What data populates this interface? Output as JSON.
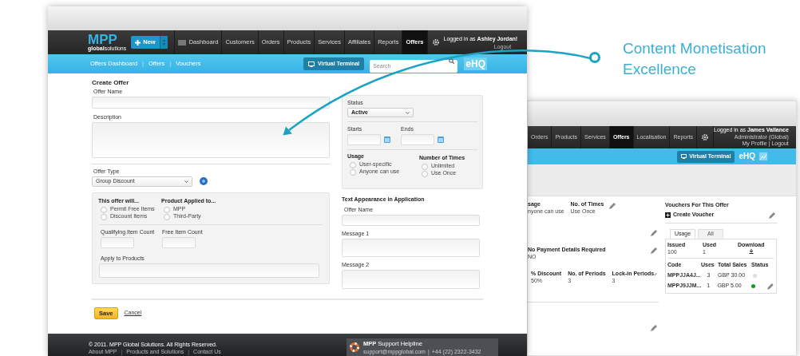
{
  "callout": {
    "text": "Content Monetisation Excellence"
  },
  "front": {
    "logo": {
      "main": "MPP",
      "sub": "**global**solutions"
    },
    "new_button": "New",
    "nav": [
      {
        "label": "Dashboard",
        "selected": false
      },
      {
        "label": "Customers",
        "selected": false
      },
      {
        "label": "Orders",
        "selected": false
      },
      {
        "label": "Products",
        "selected": false
      },
      {
        "label": "Services",
        "selected": false
      },
      {
        "label": "Affiliates",
        "selected": false
      },
      {
        "label": "Reports",
        "selected": false
      },
      {
        "label": "Offers",
        "selected": true
      }
    ],
    "user": "Logged in as **Ashley Jordan!**",
    "logout": "Logout",
    "subnav": [
      {
        "kind": "link",
        "text": "Offers Dashboard"
      },
      {
        "kind": "sep",
        "text": "|"
      },
      {
        "kind": "link",
        "text": "Offers"
      },
      {
        "kind": "sep",
        "text": "|"
      },
      {
        "kind": "link",
        "text": "Vouchers"
      }
    ],
    "virtual_terminal": "Virtual Terminal",
    "search": {
      "placeholder": "Search"
    },
    "ehq": "eHQ",
    "title": "Create Offer",
    "offer_name_label": "Offer Name",
    "description_label": "Description",
    "offer_type_label": "Offer Type",
    "offer_type": "Group Discount",
    "offer_will": {
      "title": "This offer will...",
      "options": [
        {
          "label": "Permit Free Items",
          "selected": false
        },
        {
          "label": "Discount Items",
          "selected": false
        }
      ]
    },
    "applied_to": {
      "title": "Product Applied to...",
      "options": [
        {
          "label": "MPP",
          "selected": false
        },
        {
          "label": "Third-Party",
          "selected": false
        }
      ]
    },
    "qualifying_label": "Qualifying Item Count",
    "free_label": "Free Item Count",
    "apply_label": "Apply to Products",
    "status_label": "Status",
    "status": "Active",
    "starts_label": "Starts",
    "ends_label": "Ends",
    "usage": {
      "title": "Usage",
      "options": [
        {
          "label": "User-specific",
          "selected": false
        },
        {
          "label": "Anyone can use",
          "selected": false
        }
      ]
    },
    "times": {
      "title": "Number of Times",
      "options": [
        {
          "label": "Unlimited",
          "selected": false
        },
        {
          "label": "Use Once",
          "selected": false
        }
      ]
    },
    "text_appearance": "Text Appearance in Application",
    "app_offer_name_label": "Offer Name",
    "message1_label": "Message 1",
    "message2_label": "Message 2",
    "save": "Save",
    "cancel": "Cancel",
    "footer": {
      "copyright": "© 2011. MPP Global Solutions. All Rights Reserved.",
      "links": [
        {
          "kind": "link",
          "text": "About MPP"
        },
        {
          "kind": "sep",
          "text": "|"
        },
        {
          "kind": "link",
          "text": "Products and Solutions"
        },
        {
          "kind": "sep",
          "text": "|"
        },
        {
          "kind": "link",
          "text": "Contact Us"
        }
      ],
      "helpline": "**MPP** Support Helpline",
      "email": "support@mppglobal.com",
      "sep": "|",
      "phone": "+44 (22) 2322-3432"
    }
  },
  "back": {
    "nav": [
      {
        "label": "Orders",
        "selected": false
      },
      {
        "label": "Products",
        "selected": false
      },
      {
        "label": "Services",
        "selected": false
      },
      {
        "label": "Offers",
        "selected": true
      },
      {
        "label": "Localisation",
        "selected": false
      },
      {
        "label": "Reports",
        "selected": false
      }
    ],
    "user": "Logged in as **James Vallance**",
    "role": "Administrator (Global)",
    "profile": "My Profile",
    "sep": "|",
    "logout": "Logout",
    "virtual_terminal": "Virtual Terminal",
    "ehq": "eHQ",
    "block_a": [
      {
        "label": "sage",
        "value": "nyone can use"
      },
      {
        "label": "No. of Times",
        "value": "Use Once"
      }
    ],
    "block_b": [
      {
        "label": "No Payment Details Required",
        "value": "NO"
      }
    ],
    "block_c": [
      {
        "label": "% Discount",
        "value": "50%"
      },
      {
        "label": "No. of Periods",
        "value": "3"
      },
      {
        "label": "Lock-in Periods",
        "value": "3"
      }
    ],
    "vouchers_title": "Vouchers For This Offer",
    "create_voucher": "Create Voucher",
    "tabs": [
      {
        "label": "Usage",
        "selected": true
      },
      {
        "label": "All",
        "selected": false
      }
    ],
    "stats": [
      {
        "label": "Issued",
        "value": "100"
      },
      {
        "label": "Used",
        "value": "1"
      }
    ],
    "download": "Download",
    "columns": [
      "Code",
      "Uses",
      "Total Sales",
      "Status"
    ],
    "rows": [
      {
        "code": "MPPJJA4J...",
        "uses": "3",
        "sales": "GBP 30.00",
        "color": "#dddddd"
      },
      {
        "code": "MPPJ9JJM...",
        "uses": "1",
        "sales": "GBP 5.00",
        "color": "#1a9a1a"
      }
    ]
  }
}
